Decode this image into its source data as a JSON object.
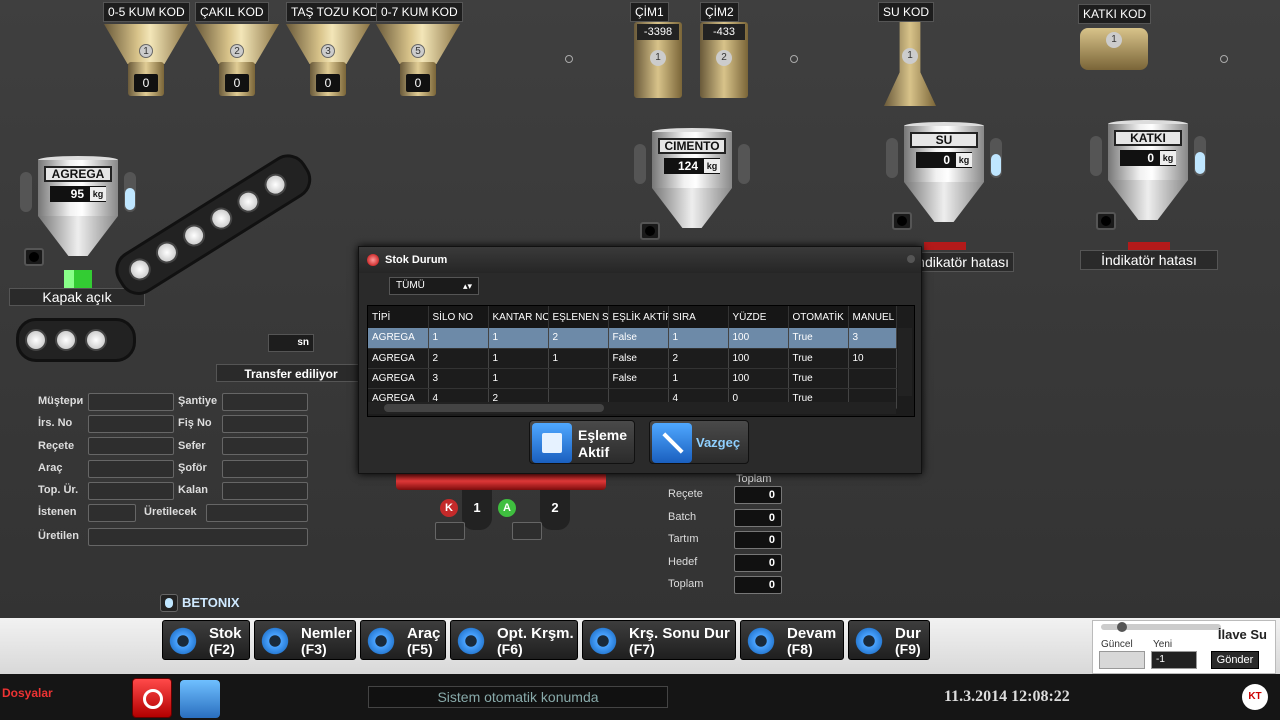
{
  "hoppers": [
    {
      "label": "0-5 KUM KOD",
      "num": "1",
      "value": "0"
    },
    {
      "label": "ÇAKIL KOD",
      "num": "2",
      "value": "0"
    },
    {
      "label": "TAŞ TOZU KOD",
      "num": "3",
      "value": "0"
    },
    {
      "label": "0-7 KUM KOD",
      "num": "5",
      "value": "0"
    }
  ],
  "cim1": {
    "label": "ÇİM1",
    "value": "-3398",
    "num": "1"
  },
  "cim2": {
    "label": "ÇİM2",
    "value": "-433",
    "num": "2"
  },
  "su_kod": {
    "label": "SU KOD",
    "num": "1"
  },
  "katki_kod": {
    "label": "KATKI KOD",
    "num": "1"
  },
  "silos": {
    "agrega": {
      "name": "AGREGA",
      "value": "95",
      "unit": "kg"
    },
    "cimento": {
      "name": "CIMENTO",
      "value": "124",
      "unit": "kg"
    },
    "su": {
      "name": "SU",
      "value": "0",
      "unit": "kg"
    },
    "katki": {
      "name": "KATKI",
      "value": "0",
      "unit": "kg"
    }
  },
  "status": {
    "kapak": "Kapak açık",
    "transfer": "Transfer ediliyor",
    "su_indicator": "İndikatör hatası",
    "katki_indicator": "İndikatör hatası",
    "sn": "sn"
  },
  "form": {
    "musteri": "Müştери",
    "santiye": "Şantiye",
    "irs_no": "İrs. No",
    "fis_no": "Fiş No",
    "recete": "Reçete",
    "sefer": "Sefer",
    "arac": "Araç",
    "sofor": "Şoför",
    "top_ur": "Top. Ür.",
    "kalan": "Kalan",
    "istenen": "İstenen",
    "uretilecek": "Üretilecek",
    "uretilen": "Üretilen"
  },
  "counters": {
    "toplam_header": "Toplam",
    "recete": {
      "label": "Reçete",
      "value": "0"
    },
    "batch": {
      "label": "Batch",
      "value": "0"
    },
    "tartim": {
      "label": "Tartım",
      "value": "0"
    },
    "hedef": {
      "label": "Hedef",
      "value": "0"
    },
    "toplam": {
      "label": "Toplam",
      "value": "0"
    }
  },
  "mixer": {
    "k": "K",
    "a": "A",
    "n1": "1",
    "n2": "2"
  },
  "brand": "BETONIX",
  "dialog": {
    "title": "Stok Durum",
    "filter": "TÜMÜ",
    "columns": [
      "TİPİ",
      "SİLO NO",
      "KANTAR NO",
      "EŞLENEN SİLO",
      "EŞLİK AKTİF",
      "SIRA",
      "YÜZDE",
      "OTOMATİK",
      "MANUEL N"
    ],
    "rows": [
      [
        "AGREGA",
        "1",
        "1",
        "2",
        "False",
        "1",
        "100",
        "True",
        "3"
      ],
      [
        "AGREGA",
        "2",
        "1",
        "1",
        "False",
        "2",
        "100",
        "True",
        "10"
      ],
      [
        "AGREGA",
        "3",
        "1",
        "",
        "False",
        "1",
        "100",
        "True",
        ""
      ],
      [
        "AGREGA",
        "4",
        "2",
        "",
        "",
        "4",
        "0",
        "True",
        ""
      ]
    ],
    "btn_esleme_1": "Eşleme",
    "btn_esleme_2": "Aktif",
    "btn_vazgec": "Vazgeç"
  },
  "fbuttons": [
    {
      "t1": "Stok",
      "t2": "(F2)"
    },
    {
      "t1": "Nemler",
      "t2": "(F3)"
    },
    {
      "t1": "Araç",
      "t2": "(F5)"
    },
    {
      "t1": "Opt. Krşm.",
      "t2": "(F6)"
    },
    {
      "t1": "Krş. Sonu Dur",
      "t2": "(F7)"
    },
    {
      "t1": "Devam",
      "t2": "(F8)"
    },
    {
      "t1": "Dur",
      "t2": "(F9)"
    }
  ],
  "ilave": {
    "title": "İlave Su",
    "guncel": "Güncel",
    "yeni": "Yeni",
    "yeni_value": "-1",
    "gonder": "Gönder"
  },
  "bottombar": {
    "dosyalar": "Dosyalar",
    "status": "Sistem otomatik konumda",
    "datetime": "11.3.2014 12:08:22",
    "logo": "KT"
  }
}
